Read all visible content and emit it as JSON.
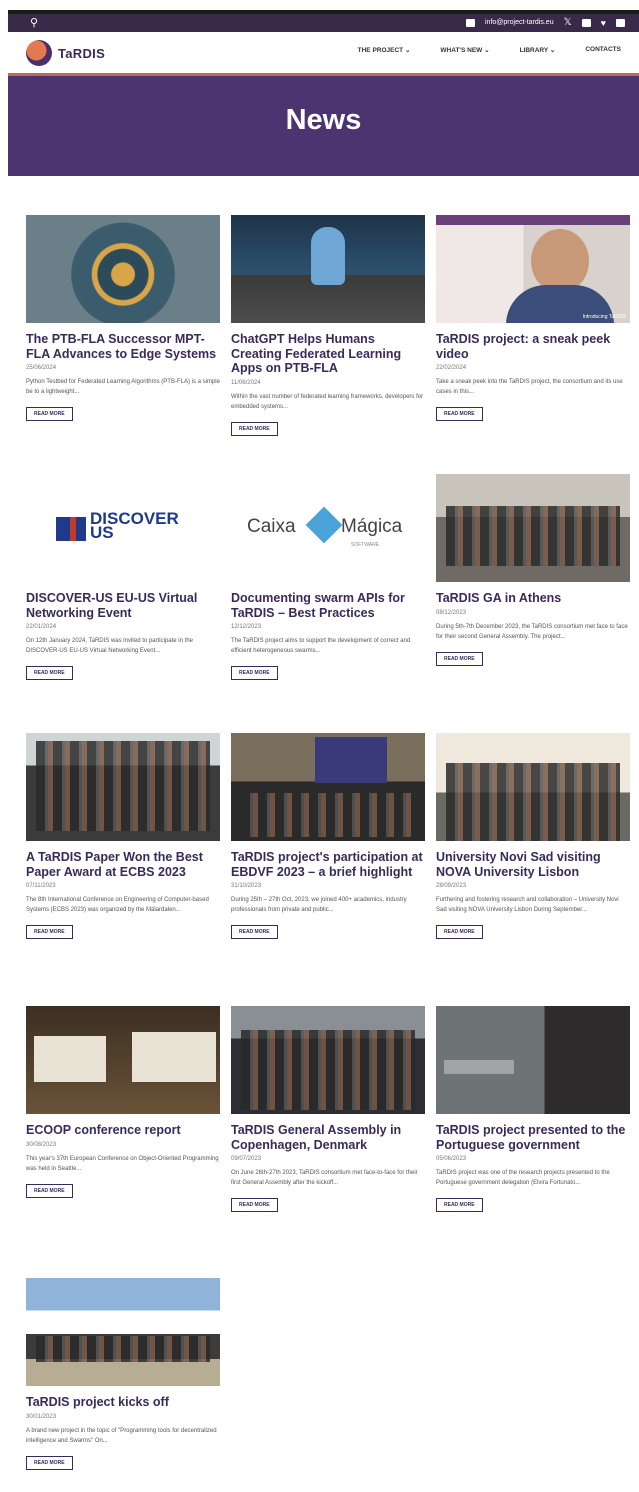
{
  "topbar": {
    "email": "info@project-tardis.eu"
  },
  "brand": {
    "name": "TaRDIS"
  },
  "nav": [
    {
      "label": "THE PROJECT"
    },
    {
      "label": "WHAT'S NEW"
    },
    {
      "label": "LIBRARY"
    },
    {
      "label": "CONTACTS"
    }
  ],
  "hero": {
    "title": "News"
  },
  "read_more": "READ MORE",
  "thumb_text": {
    "discover_line1": "DISCOVER",
    "discover_line2": "US",
    "caixa": "Caixa",
    "magica": "Mágica",
    "magica_sub": "SOFTWARE",
    "introducing": "Introducing TaRDIS"
  },
  "posts": [
    {
      "title": "The PTB-FLA Successor MPT-FLA Advances to Edge Systems",
      "date": "25/06/2024",
      "excerpt": "Python Testbed for Federated Learning Algorithms (PTB-FLA) is a simple be to a lightweight..."
    },
    {
      "title": "ChatGPT Helps Humans Creating Federated Learning Apps on PTB-FLA",
      "date": "11/06/2024",
      "excerpt": "Within the vast number of federated learning frameworks, developers for embedded systems..."
    },
    {
      "title": "TaRDIS project: a sneak peek video",
      "date": "22/02/2024",
      "excerpt": "Take a sneak peek into the TaRDIS project, the consortium and its use cases in this..."
    },
    {
      "title": "DISCOVER-US EU-US Virtual Networking Event",
      "date": "22/01/2024",
      "excerpt": "On 12th January 2024, TaRDIS was invited to participate in the DISCOVER-US EU-US Virtual Networking Event..."
    },
    {
      "title": "Documenting swarm APIs for TaRDIS – Best Practices",
      "date": "12/12/2023",
      "excerpt": "The TaRDIS project aims to support the development of correct and efficient heterogeneous swarms..."
    },
    {
      "title": "TaRDIS GA in Athens",
      "date": "08/12/2023",
      "excerpt": "During 5th-7th December 2023, the TaRDIS consortium met face to face for their second General Assembly. The project..."
    },
    {
      "title": "A TaRDIS Paper Won the Best Paper Award at ECBS 2023",
      "date": "07/11/2023",
      "excerpt": "The 8th International Conference on Engineering of Computer-based Systems (ECBS 2023) was organized by the Mälardalen..."
    },
    {
      "title": "TaRDIS project's participation at EBDVF 2023 – a brief highlight",
      "date": "31/10/2023",
      "excerpt": "During 25th – 27th Oct, 2023, we joined 400+ academics, industry professionals from private and public..."
    },
    {
      "title": "University Novi Sad visiting NOVA University Lisbon",
      "date": "28/09/2023",
      "excerpt": "Furthering and fostering research and collaboration – University Novi Sad visiting NOVA University Lisbon During September..."
    },
    {
      "title": "ECOOP conference report",
      "date": "30/08/2023",
      "excerpt": "This year's 37th European Conference on Object-Oriented Programming was held in Seattle..."
    },
    {
      "title": "TaRDIS General Assembly in Copenhagen, Denmark",
      "date": "09/07/2023",
      "excerpt": "On June 26th-27th 2023, TaRDIS consortium met face-to-face for their first General Assembly after the kickoff..."
    },
    {
      "title": "TaRDIS project presented to the Portuguese government",
      "date": "05/06/2023",
      "excerpt": "TaRDIS project was one of the research projects presented to the Portuguese government delegation (Elvira Fortunato..."
    },
    {
      "title": "TaRDIS project kicks off",
      "date": "30/01/2023",
      "excerpt": "A brand new project in the topic of \"Programming tools for decentralized intelligence and Swarms\" On..."
    }
  ]
}
